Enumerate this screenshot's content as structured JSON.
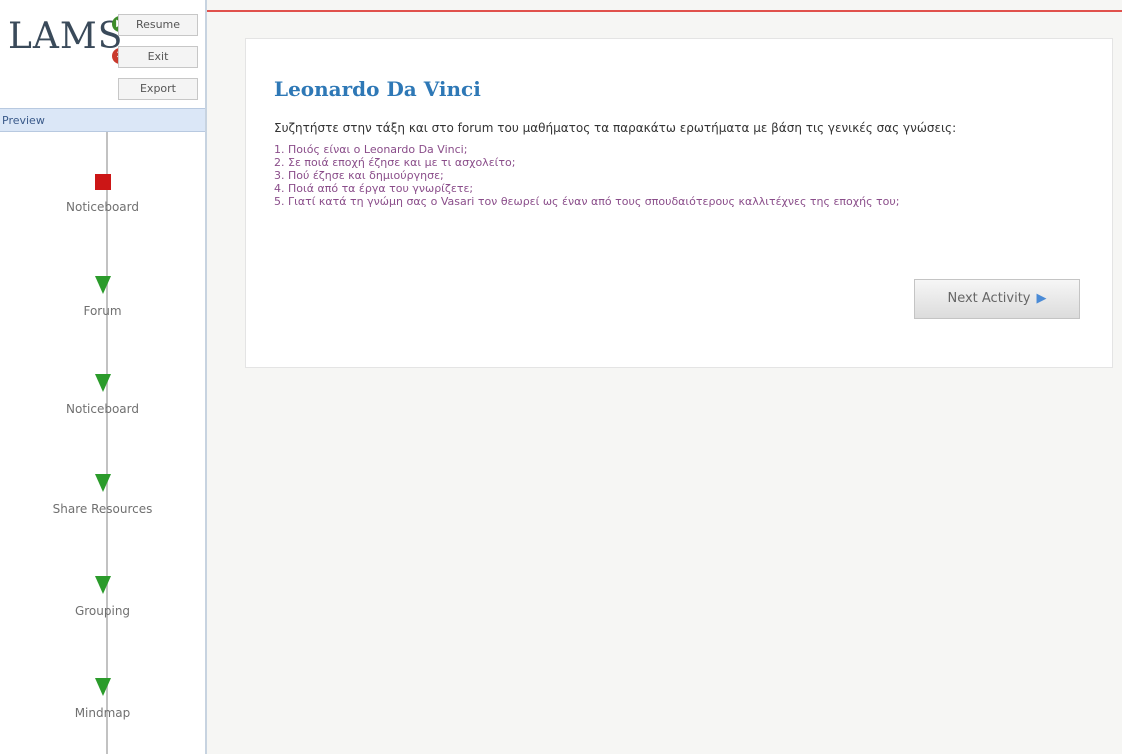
{
  "app": {
    "logo_text": "LAMS"
  },
  "controls": {
    "resume": "Resume",
    "exit": "Exit",
    "export": "Export"
  },
  "sidebar": {
    "preview_label": "Preview",
    "activities": [
      {
        "label": "Noticeboard",
        "icon": "red-square-icon"
      },
      {
        "label": "Forum",
        "icon": "green-triangle-icon"
      },
      {
        "label": "Noticeboard",
        "icon": "green-triangle-icon"
      },
      {
        "label": "Share Resources",
        "icon": "green-triangle-icon"
      },
      {
        "label": "Grouping",
        "icon": "green-triangle-icon"
      },
      {
        "label": "Mindmap",
        "icon": "green-triangle-icon"
      }
    ]
  },
  "content": {
    "title": "Leonardo Da Vinci",
    "intro": "Συζητήστε στην τάξη και στο forum του μαθήματος τα παρακάτω ερωτήματα με βάση τις γενικές σας γνώσεις:",
    "questions": [
      "1. Ποιός είναι ο Leonardo Da Vinci;",
      "2. Σε ποιά εποχή έζησε και με τι ασχολείτο;",
      "3. Πού έζησε και δημιούργησε;",
      "4. Ποιά από τα έργα του γνωρίζετε;",
      "5. Γιατί κατά τη γνώμη σας ο Vasari τον θεωρεί ως έναν από τους σπουδαιότερους καλλιτέχνες της εποχής του;"
    ],
    "next_button": "Next Activity"
  },
  "colors": {
    "title": "#2e78b6",
    "question_text": "#8a4d8a",
    "current_activity": "#cc1616",
    "activity_arrow": "#2b9b2b",
    "header_line": "#e0514c"
  }
}
